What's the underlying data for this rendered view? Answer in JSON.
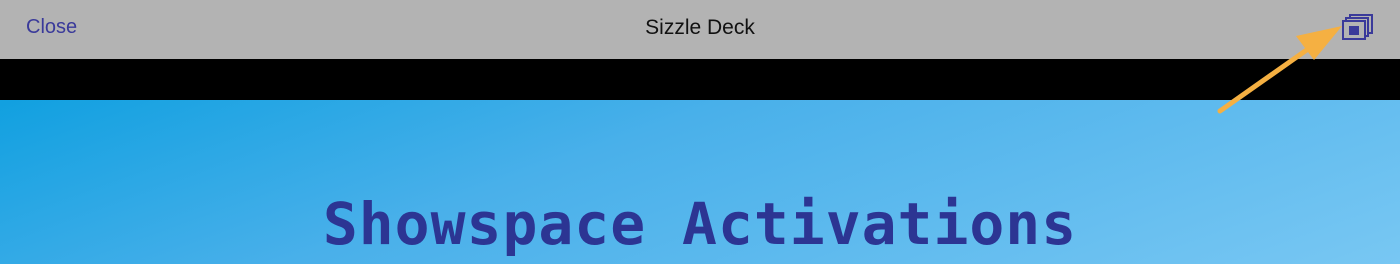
{
  "navbar": {
    "close_label": "Close",
    "title": "Sizzle Deck",
    "deck_icon": "stacked-slides-icon"
  },
  "slide": {
    "title": "Showspace Activations"
  },
  "colors": {
    "navbar_bg": "#b3b3b3",
    "accent": "#3a3a9a",
    "slide_title": "#2c3593",
    "arrow": "#f5b042"
  }
}
